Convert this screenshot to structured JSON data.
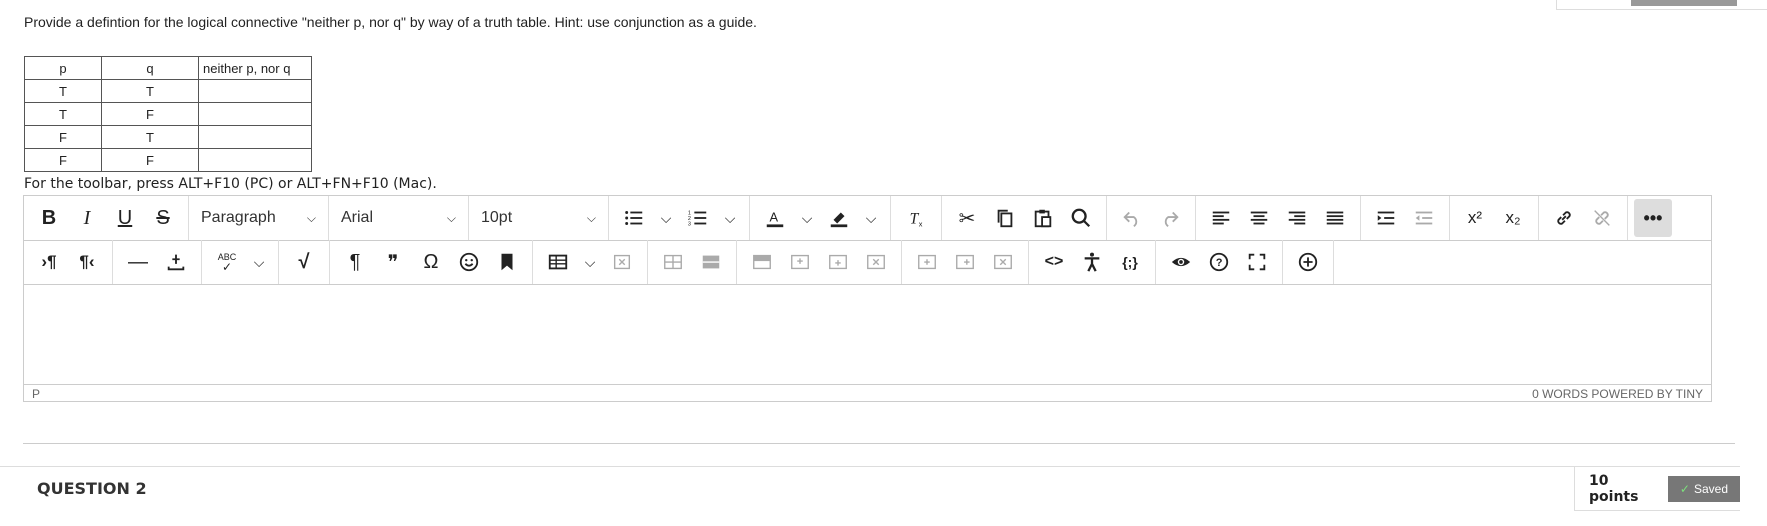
{
  "question": {
    "prompt": "Provide a defintion for the logical connective \"neither p, nor q\" by way of a truth table. Hint: use conjunction as a guide."
  },
  "truth_table": {
    "headers": [
      "p",
      "q",
      "neither p, nor q"
    ],
    "rows": [
      [
        "T",
        "T",
        ""
      ],
      [
        "T",
        "F",
        ""
      ],
      [
        "F",
        "T",
        ""
      ],
      [
        "F",
        "F",
        ""
      ]
    ]
  },
  "editor": {
    "toolbar_hint": "For the toolbar, press ALT+F10 (PC) or ALT+FN+F10 (Mac).",
    "block_format": "Paragraph",
    "font_family": "Arial",
    "font_size": "10pt",
    "status_path": "P",
    "status_right": "0 WORDS  POWERED BY TINY",
    "toolbar_labels": {
      "bold": "B",
      "italic": "I",
      "underline": "U",
      "strikethrough": "S",
      "superscript": "x²",
      "subscript": "x₂",
      "more": "•••",
      "ltr": "¶",
      "rtl": "¶",
      "hr": "—",
      "spellcheck": "ABC",
      "math": "√",
      "pilcrow": "¶",
      "quote": "❞",
      "omega": "Ω",
      "code": "<>",
      "var": "{;}"
    }
  },
  "question2": {
    "title": "QUESTION 2",
    "points": "10 points",
    "status": "Saved"
  },
  "colors": {
    "border": "#cccccc",
    "saved_bg": "#777777",
    "saved_check": "#7de07d"
  }
}
